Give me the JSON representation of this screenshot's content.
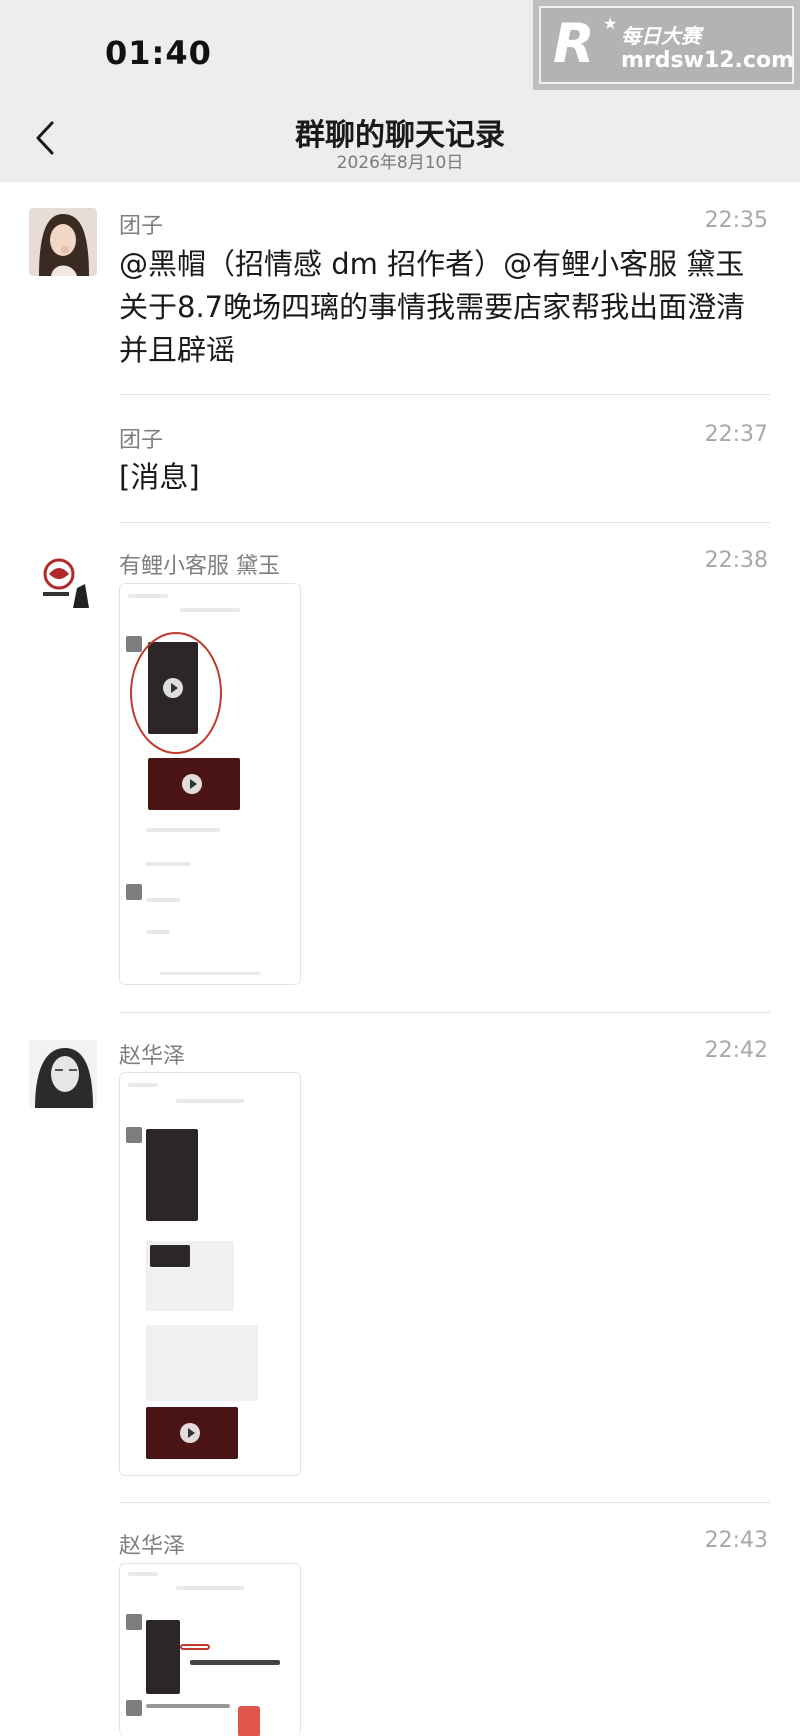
{
  "status_bar": {
    "time": "01:40"
  },
  "watermark": {
    "logo": "R",
    "brand_cn": "每日大赛",
    "url": "mrdsw12.com"
  },
  "header": {
    "title": "群聊的聊天记录",
    "subtitle": "2026年8月10日",
    "back_icon": "chevron-left-icon"
  },
  "messages": [
    {
      "sender": "团子",
      "time": "22:35",
      "text": "@黑帽（招情感 dm 招作者）@有鲤小客服 黛玉 关于8.7晚场四璃的事情我需要店家帮我出面澄清并且辟谣"
    },
    {
      "sender": "团子",
      "time": "22:37",
      "text": "[消息]"
    },
    {
      "sender": "有鲤小客服 黛玉",
      "time": "22:38",
      "type": "image"
    },
    {
      "sender": "赵华泽",
      "time": "22:42",
      "type": "image"
    },
    {
      "sender": "赵华泽",
      "time": "22:43",
      "type": "image"
    }
  ],
  "colors": {
    "header_bg": "#ededed",
    "accent_red": "#c0392b",
    "divider": "#e3e3e3"
  }
}
